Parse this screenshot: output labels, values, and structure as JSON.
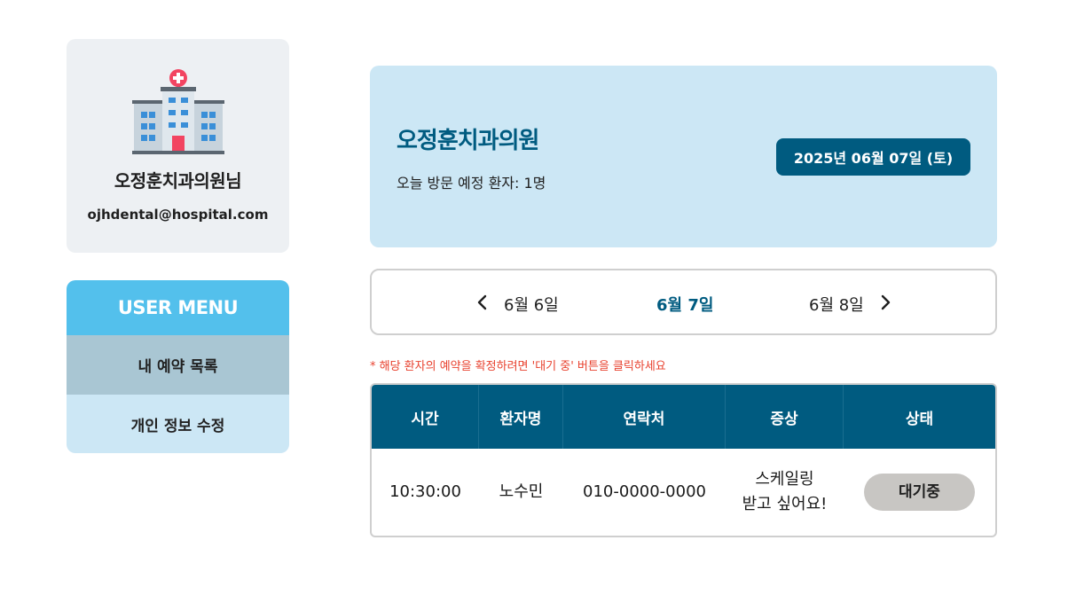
{
  "profile": {
    "icon": "hospital-icon",
    "name": "오정훈치과의원님",
    "email": "ojhdental@hospital.com"
  },
  "menu": {
    "title": "USER MENU",
    "items": [
      {
        "label": "내 예약 목록",
        "active": true
      },
      {
        "label": "개인 정보 수정",
        "active": false
      }
    ]
  },
  "banner": {
    "title": "오정훈치과의원",
    "subtitle": "오늘 방문 예정 환자: 1명",
    "date": "2025년 06월 07일 (토)"
  },
  "date_nav": {
    "prev_icon": "chevron-left-icon",
    "next_icon": "chevron-right-icon",
    "prev_day": "6월 6일",
    "current_day": "6월 7일",
    "next_day": "6월 8일"
  },
  "notice": "* 해당 환자의 예약을 확정하려면 '대기 중' 버튼을 클릭하세요",
  "table": {
    "headers": [
      "시간",
      "환자명",
      "연락처",
      "증상",
      "상태"
    ],
    "rows": [
      {
        "time": "10:30:00",
        "patient": "노수민",
        "phone": "010-0000-0000",
        "symptom": "스케일링 받고 싶어요!",
        "status": "대기중"
      }
    ]
  },
  "colors": {
    "primary": "#005b80",
    "menu_header": "#53c0ec",
    "light_blue": "#cce7f5",
    "active_item": "#a9c6d3",
    "notice_red": "#e8412e",
    "status_gray": "#c8c6c3"
  }
}
